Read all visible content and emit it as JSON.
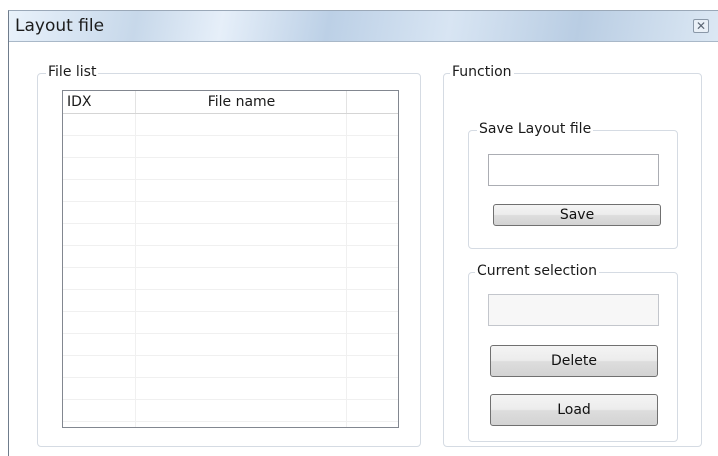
{
  "window": {
    "title": "Layout file",
    "close_glyph": "✕"
  },
  "file_list": {
    "group_label": "File list",
    "columns": [
      "IDX",
      "File name",
      ""
    ],
    "rows": []
  },
  "function": {
    "group_label": "Function",
    "save_group": {
      "label": "Save Layout file",
      "filename_value": "",
      "save_label": "Save"
    },
    "current_group": {
      "label": "Current selection",
      "selection_value": "",
      "delete_label": "Delete",
      "load_label": "Load"
    }
  }
}
